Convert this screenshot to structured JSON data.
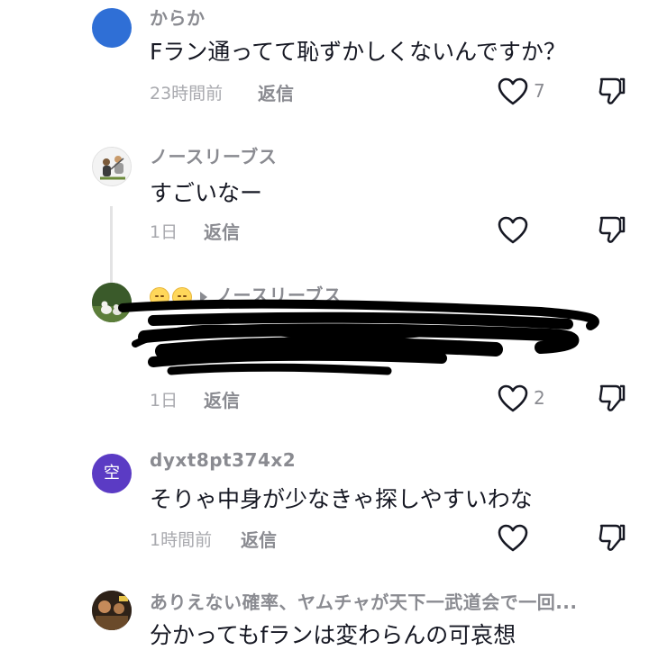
{
  "comments": [
    {
      "username": "からか",
      "text": "Fラン通ってて恥ずかしくないんですか？",
      "time": "23時間前",
      "reply_label": "返信",
      "likes": "7",
      "avatar_color": "#2f6fd6"
    },
    {
      "username": "ノースリーブス",
      "text": "すごいなー",
      "time": "1日",
      "reply_label": "返信",
      "likes": ""
    },
    {
      "reply_to": "ノースリーブス",
      "text": "",
      "time": "1日",
      "reply_label": "返信",
      "likes": "2"
    },
    {
      "username": "dyxt8pt374x2",
      "avatar_char": "空",
      "text": "そりゃ中身が少なきゃ探しやすいわな",
      "time": "1時間前",
      "reply_label": "返信",
      "likes": "",
      "avatar_color": "#5b3bc4"
    },
    {
      "username": "ありえない確率、ヤムチャが天下一武道会で一回...",
      "text": "分かってもfランは変わらんの可哀想"
    }
  ],
  "colors": {
    "username": "#8a8b91",
    "body_text": "#161823",
    "time": "#a8a9ae",
    "thread_line": "#e3e3e4"
  }
}
